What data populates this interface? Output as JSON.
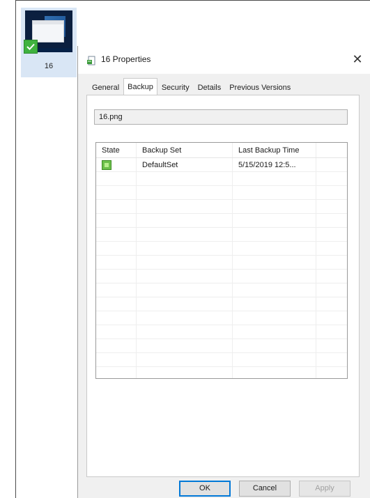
{
  "thumbnail": {
    "label": "16",
    "check_icon": "check-icon"
  },
  "dialog": {
    "title": "16 Properties",
    "close_glyph": "✕",
    "tabs": [
      {
        "label": "General",
        "active": false
      },
      {
        "label": "Backup",
        "active": true
      },
      {
        "label": "Security",
        "active": false
      },
      {
        "label": "Details",
        "active": false
      },
      {
        "label": "Previous Versions",
        "active": false
      }
    ],
    "filename": "16.png",
    "list": {
      "headers": {
        "state": "State",
        "backup_set": "Backup Set",
        "last_backup_time": "Last Backup Time"
      },
      "rows": [
        {
          "state_icon": "backup-ok-icon",
          "backup_set": "DefaultSet",
          "last_backup_time": "5/15/2019 12:5..."
        }
      ]
    },
    "buttons": {
      "ok": "OK",
      "cancel": "Cancel",
      "apply": "Apply"
    }
  }
}
